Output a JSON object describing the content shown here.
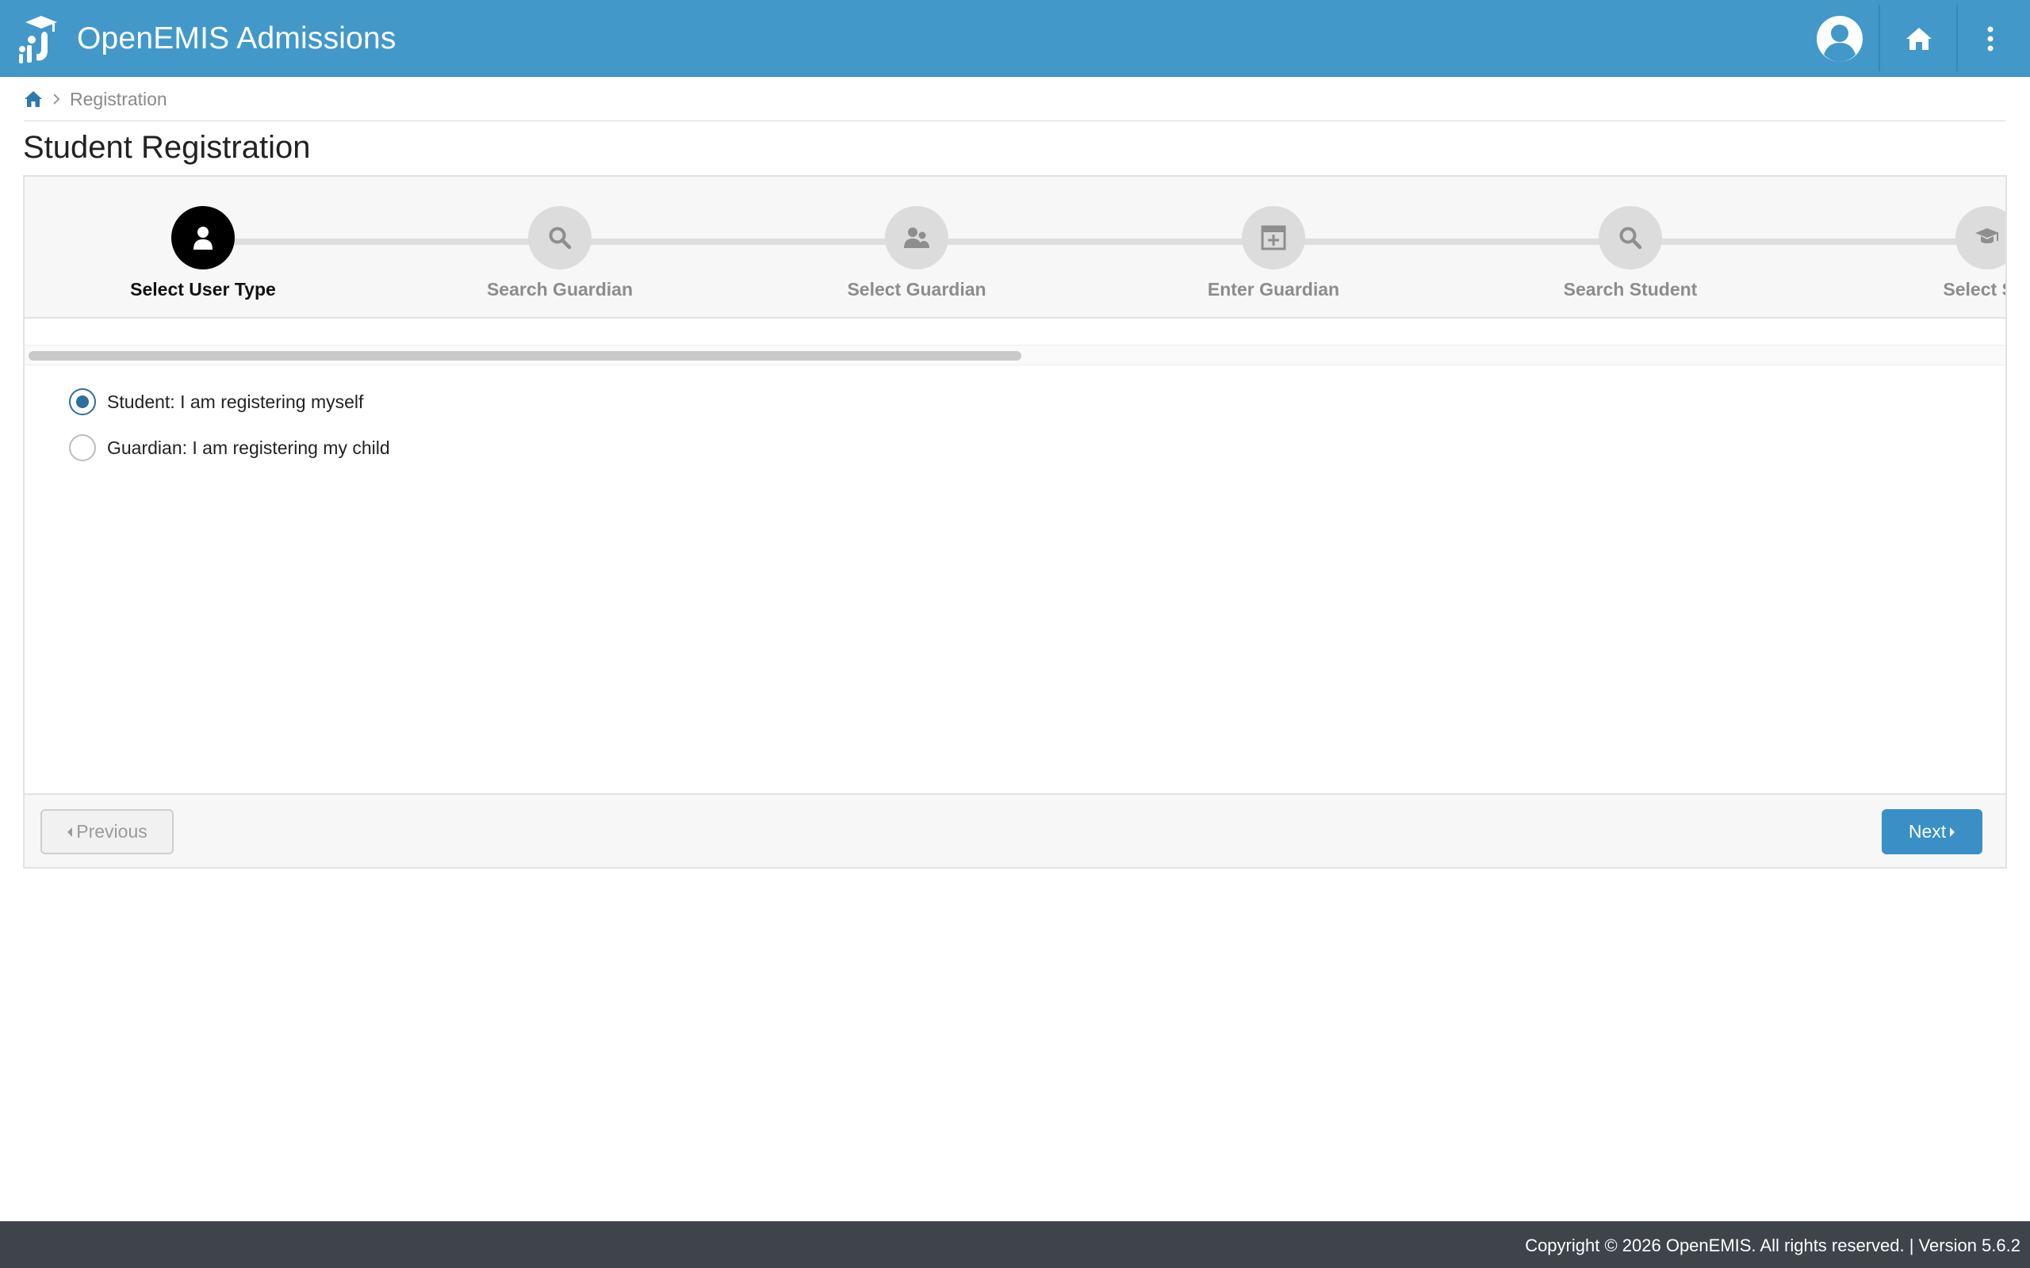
{
  "header": {
    "app_title": "OpenEMIS Admissions",
    "icons": [
      "graduation-logo-icon",
      "user-avatar-icon",
      "home-icon",
      "more-vertical-icon"
    ],
    "colors": {
      "bar": "#4298c9",
      "accent": "#3a8fc6"
    }
  },
  "breadcrumb": {
    "home_icon": "home-icon",
    "current": "Registration"
  },
  "page": {
    "title": "Student Registration"
  },
  "wizard": {
    "steps": [
      {
        "label": "Select User Type",
        "icon": "user-icon",
        "active": true
      },
      {
        "label": "Search Guardian",
        "icon": "search-icon",
        "active": false
      },
      {
        "label": "Select Guardian",
        "icon": "users-icon",
        "active": false
      },
      {
        "label": "Enter Guardian",
        "icon": "plus-square-icon",
        "active": false
      },
      {
        "label": "Search Student",
        "icon": "search-icon",
        "active": false
      },
      {
        "label": "Select Stu",
        "icon": "graduation-cap-icon",
        "active": false
      }
    ]
  },
  "form": {
    "options": [
      {
        "label": "Student: I am registering myself",
        "checked": true
      },
      {
        "label": "Guardian: I am registering my child",
        "checked": false
      }
    ]
  },
  "actions": {
    "previous_label": "Previous",
    "next_label": "Next"
  },
  "footer": {
    "text": "Copyright © 2026 OpenEMIS. All rights reserved. | Version 5.6.2"
  }
}
